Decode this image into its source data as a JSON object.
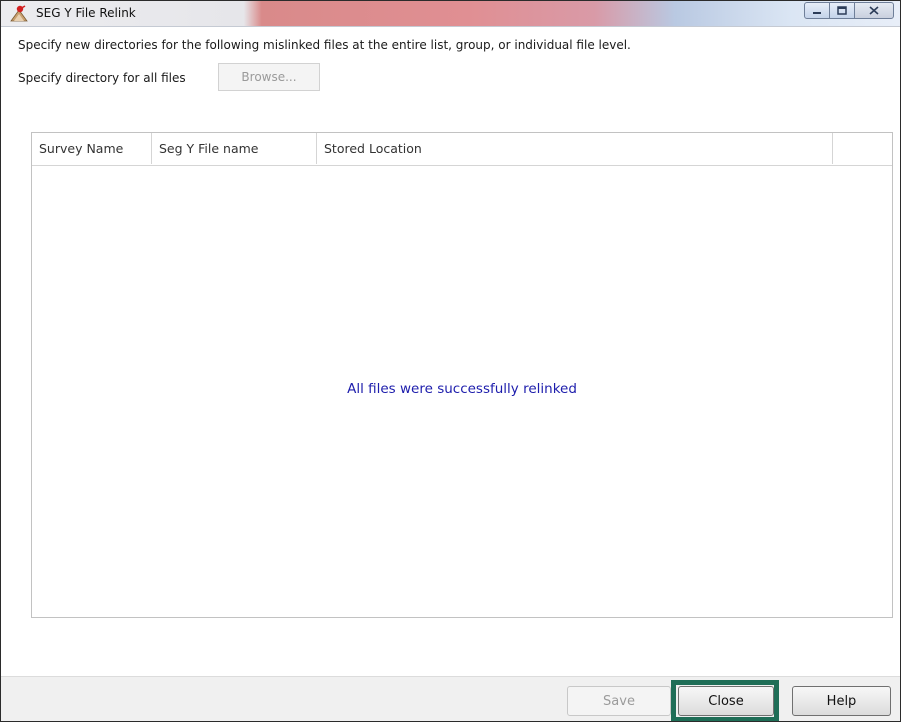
{
  "window": {
    "title": "SEG Y File Relink",
    "caption_buttons": [
      "minimize",
      "maximize",
      "close"
    ]
  },
  "instruction_text": "Specify new directories for the following mislinked files at the entire list, group, or individual file level.",
  "directory": {
    "label": "Specify directory for all files",
    "browse_label": "Browse..."
  },
  "table": {
    "columns": [
      "Survey Name",
      "Seg Y File name",
      "Stored Location",
      ""
    ],
    "rows": [],
    "empty_message": "All files were successfully relinked"
  },
  "footer": {
    "save_label": "Save",
    "close_label": "Close",
    "help_label": "Help"
  },
  "colors": {
    "message_text": "#1d1dac",
    "highlight_border": "#1f6e57"
  }
}
